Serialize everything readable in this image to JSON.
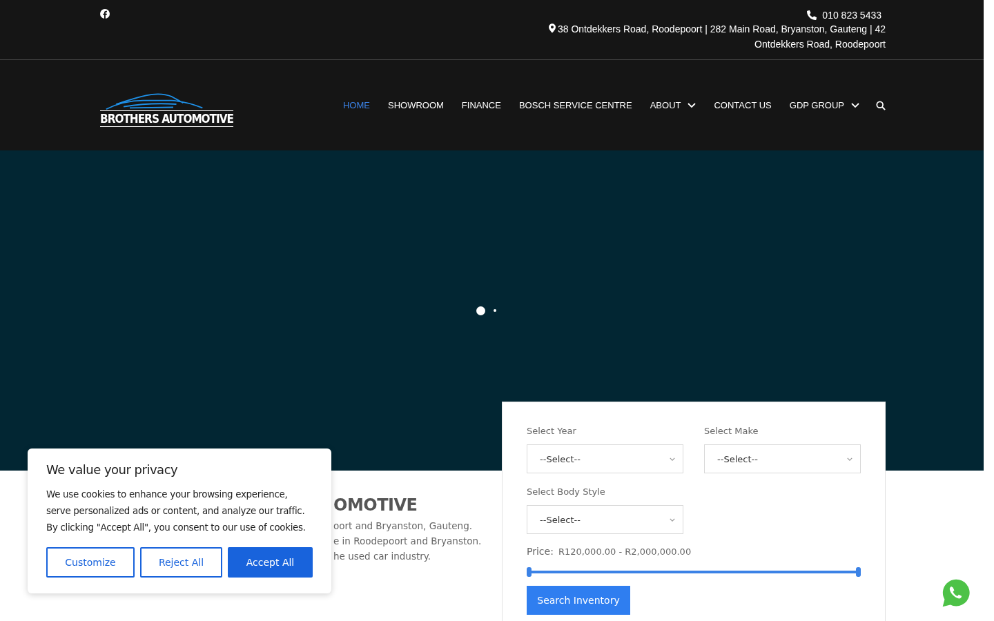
{
  "top_bar": {
    "phone": "010 823 5433",
    "address": "38 Ontdekkers Road, Roodepoort | 282 Main Road, Bryanston, Gauteng | 42 Ontdekkers Road, Roodepoort"
  },
  "logo": {
    "text": "BROTHERS AUTOMOTIVE"
  },
  "nav": [
    {
      "label": "HOME",
      "selected": true,
      "has_menu": false
    },
    {
      "label": "SHOWROOM",
      "selected": false,
      "has_menu": false
    },
    {
      "label": "FINANCE",
      "selected": false,
      "has_menu": false
    },
    {
      "label": "BOSCH SERVICE CENTRE",
      "selected": false,
      "has_menu": false
    },
    {
      "label": "ABOUT",
      "selected": false,
      "has_menu": true
    },
    {
      "label": "CONTACT US",
      "selected": false,
      "has_menu": false
    },
    {
      "label": "GDP GROUP",
      "selected": false,
      "has_menu": true
    }
  ],
  "slider_dots": [
    {
      "selected": true
    },
    {
      "selected": false
    }
  ],
  "intro": {
    "heading": "OMOTIVE",
    "lines": [
      "oort and Bryanston, Gauteng.",
      "e in Roodepoort and Bryanston.",
      "he used car industry."
    ]
  },
  "search_form": {
    "selects": [
      {
        "label": "Select Year",
        "value": "--Select--"
      },
      {
        "label": "Select Make",
        "value": "--Select--"
      },
      {
        "label": "Select Body Style",
        "value": "--Select--"
      }
    ],
    "price": {
      "label": "Price:",
      "range": "R120,000.00 - R2,000,000.00",
      "thumbs": [
        {
          "level": 0
        },
        {
          "level": 1
        }
      ]
    },
    "button": "Search Inventory"
  },
  "cookie_banner": {
    "title": "We value your privacy",
    "text": "We use cookies to enhance your browsing experience, serve personalized ads or content, and analyze our traffic. By clicking \"Accept All\", you consent to our use of cookies.",
    "buttons": [
      {
        "label": "Customize",
        "kind": "outline"
      },
      {
        "label": "Reject All",
        "kind": "outline"
      },
      {
        "label": "Accept All",
        "kind": "primary"
      }
    ]
  }
}
